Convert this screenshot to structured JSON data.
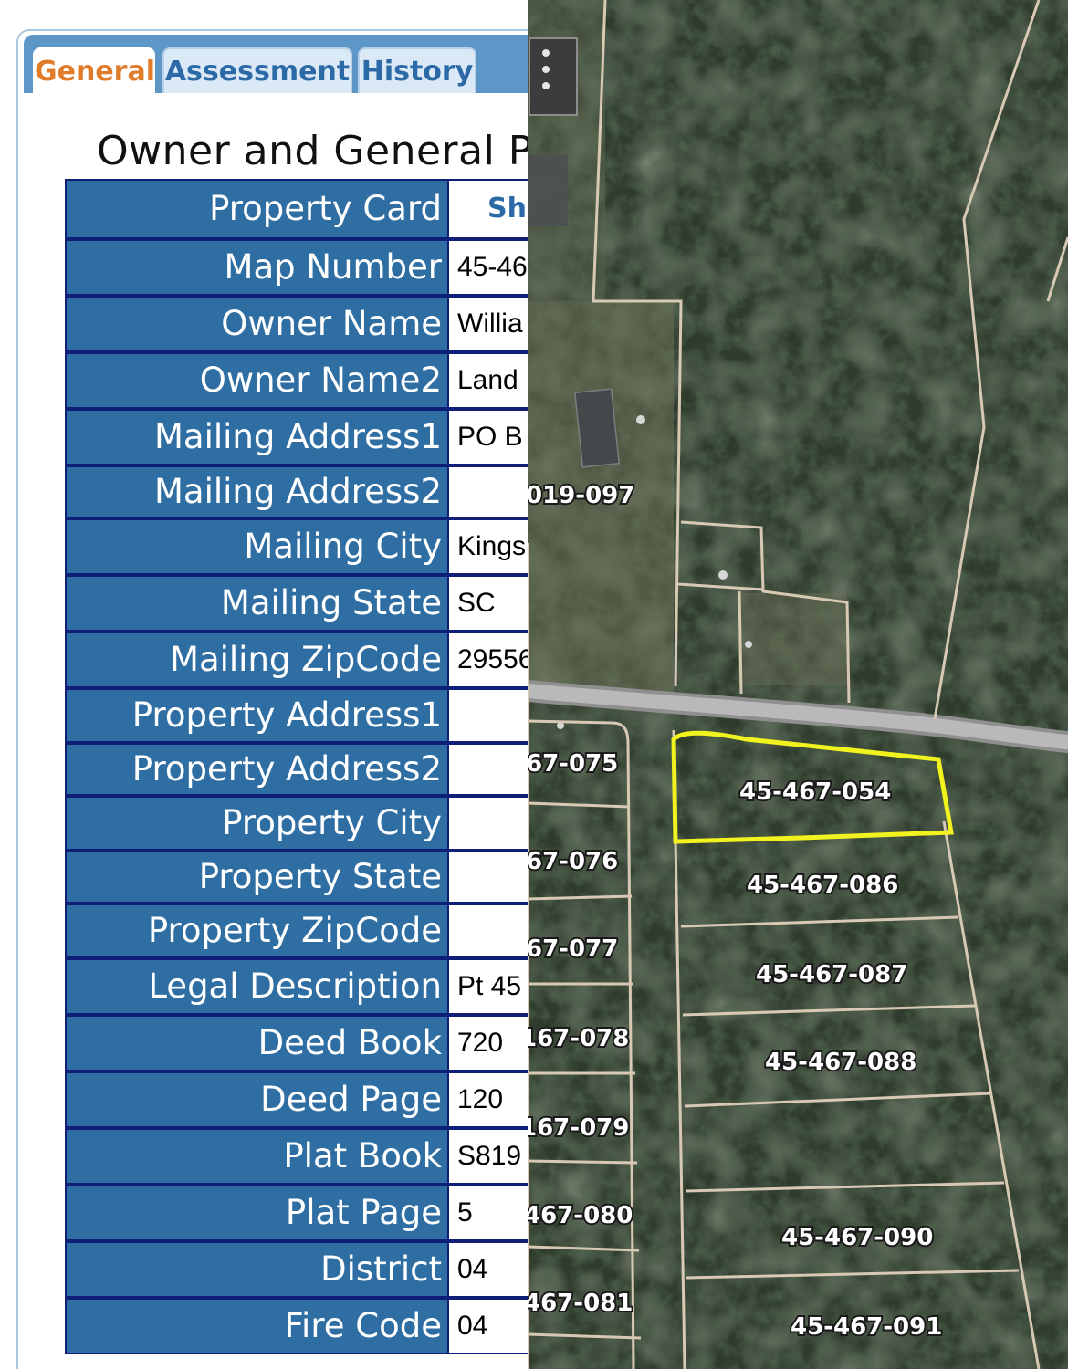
{
  "tabs": {
    "general": "General",
    "assessment": "Assessment",
    "history": "History"
  },
  "section_title": "Owner and General Pa",
  "rows": [
    {
      "label": "Property Card",
      "value": "Sh"
    },
    {
      "label": "Map Number",
      "value": "45-46"
    },
    {
      "label": "Owner Name",
      "value": "Willia"
    },
    {
      "label": "Owner Name2",
      "value": "Land"
    },
    {
      "label": "Mailing Address1",
      "value": "PO B"
    },
    {
      "label": "Mailing Address2",
      "value": ""
    },
    {
      "label": "Mailing City",
      "value": "Kings"
    },
    {
      "label": "Mailing State",
      "value": "SC"
    },
    {
      "label": "Mailing ZipCode",
      "value": "29556"
    },
    {
      "label": "Property Address1",
      "value": ""
    },
    {
      "label": "Property Address2",
      "value": ""
    },
    {
      "label": "Property City",
      "value": ""
    },
    {
      "label": "Property State",
      "value": ""
    },
    {
      "label": "Property ZipCode",
      "value": ""
    },
    {
      "label": "Legal Description",
      "value": "Pt 45"
    },
    {
      "label": "Deed Book",
      "value": "720"
    },
    {
      "label": "Deed Page",
      "value": "120"
    },
    {
      "label": "Plat Book",
      "value": "S819"
    },
    {
      "label": "Plat Page",
      "value": "5"
    },
    {
      "label": "District",
      "value": "04"
    },
    {
      "label": "Fire Code",
      "value": "04"
    }
  ],
  "map": {
    "parcels": {
      "p019_097": "019-097",
      "p67_075": "67-075",
      "p45_467_054": "45-467-054",
      "p67_076": "67-076",
      "p45_467_086": "45-467-086",
      "p67_077": "67-077",
      "p45_467_087": "45-467-087",
      "p67_078": "167-078",
      "p45_467_088": "45-467-088",
      "p67_079": "167-079",
      "p67_080": "467-080",
      "p45_467_090": "45-467-090",
      "p67_081": "467-081",
      "p45_467_091": "45-467-091"
    },
    "highlight_color": "#f2f21e",
    "parcel_line_color": "#d8c9b4"
  }
}
